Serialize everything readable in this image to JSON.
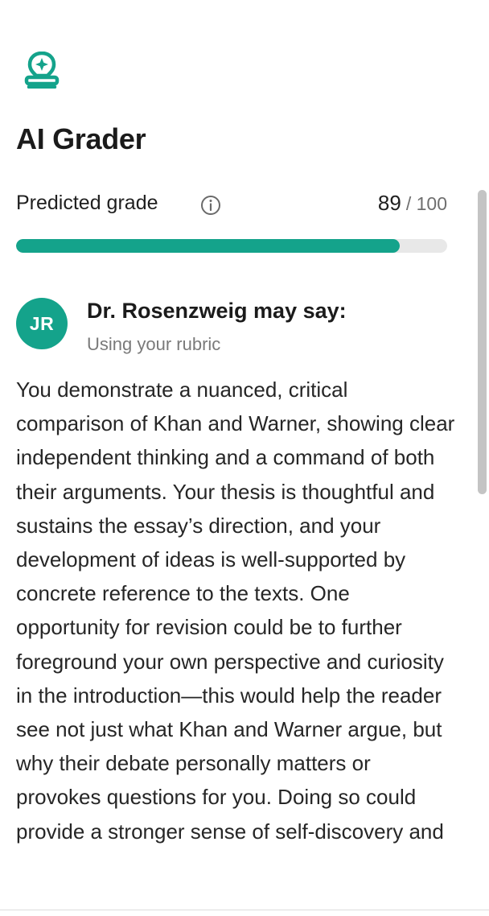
{
  "app": {
    "title": "AI Grader",
    "icon": "stamp-sparkle-icon",
    "accent_color": "#14a38b"
  },
  "grade": {
    "label": "Predicted grade",
    "info_icon": "info-icon",
    "score": "89",
    "max": "/ 100",
    "progress_percent": 89
  },
  "grader": {
    "initials": "JR",
    "name": "Dr. Rosenzweig may say:",
    "subtitle": "Using your rubric"
  },
  "feedback": {
    "text": "You demonstrate a nuanced, critical comparison of Khan and Warner, showing clear independent thinking and a command of both their arguments. Your thesis is thoughtful and sustains the essay’s direction, and your development of ideas is well-supported by concrete reference to the texts. One opportunity for revision could be to further foreground your own perspective and curiosity in the introduction—this would help the reader see not just what Khan and Warner argue, but why their debate personally matters or provokes questions for you. Doing so could provide a stronger sense of self-discovery and"
  }
}
